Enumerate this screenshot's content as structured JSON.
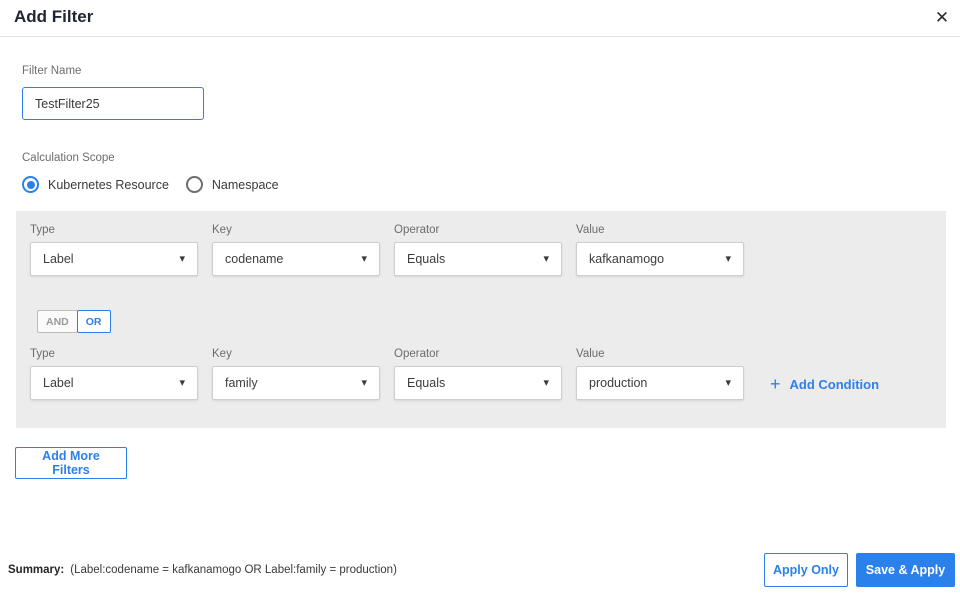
{
  "dialog": {
    "title": "Add Filter"
  },
  "icons": {
    "close_icon": "✕",
    "caret_down_icon": "▾",
    "plus_icon": "+"
  },
  "filter_name": {
    "label": "Filter Name",
    "value": "TestFilter25"
  },
  "calculation_scope": {
    "label": "Calculation Scope",
    "options": [
      {
        "label": "Kubernetes Resource",
        "selected": true
      },
      {
        "label": "Namespace",
        "selected": false
      }
    ]
  },
  "conditions": {
    "rows": [
      {
        "fields": [
          {
            "label": "Type",
            "value": "Label"
          },
          {
            "label": "Key",
            "value": "codename"
          },
          {
            "label": "Operator",
            "value": "Equals"
          },
          {
            "label": "Value",
            "value": "kafkanamogo"
          }
        ]
      },
      {
        "fields": [
          {
            "label": "Type",
            "value": "Label"
          },
          {
            "label": "Key",
            "value": "family"
          },
          {
            "label": "Operator",
            "value": "Equals"
          },
          {
            "label": "Value",
            "value": "production"
          }
        ]
      }
    ],
    "logic_toggle": {
      "and_label": "AND",
      "or_label": "OR",
      "and_selected": false,
      "or_selected": true
    },
    "add_condition_label": "Add Condition"
  },
  "add_more_filters_label": "Add More Filters",
  "footer": {
    "summary_label": "Summary:",
    "summary_text": "(Label:codename = kafkanamogo OR Label:family = production)",
    "apply_only_label": "Apply Only",
    "save_apply_label": "Save & Apply"
  },
  "colors": {
    "primary_blue": "#2b80eb",
    "panel_gray": "#ececec",
    "title_text": "#1f2633",
    "label_gray": "#6d6d6d"
  }
}
